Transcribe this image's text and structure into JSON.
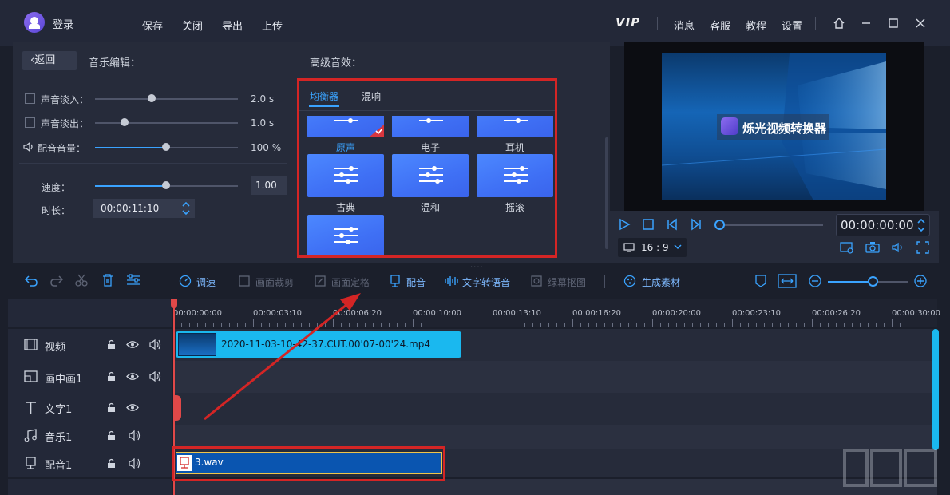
{
  "topbar": {
    "login": "登录",
    "menu": [
      "保存",
      "关闭",
      "导出",
      "上传"
    ],
    "vip": "VIP",
    "right_menu": [
      "消息",
      "客服",
      "教程",
      "设置"
    ]
  },
  "music_editor": {
    "back_label": "返回",
    "title": "音乐编辑：",
    "fade_in_label": "声音淡入：",
    "fade_in_value": "2.0 s",
    "fade_out_label": "声音淡出：",
    "fade_out_value": "1.0 s",
    "volume_label": "配音音量：",
    "volume_value": "100 %",
    "speed_label": "速度：",
    "speed_value": "1.00",
    "duration_label": "时长：",
    "duration_value": "00:00:11:10"
  },
  "advanced": {
    "title": "高级音效：",
    "tabs": [
      "均衡器",
      "混响"
    ],
    "presets_row1": [
      "原声",
      "电子",
      "耳机"
    ],
    "presets_row2": [
      "古典",
      "温和",
      "摇滚"
    ]
  },
  "preview": {
    "watermark": "烁光视频转换器",
    "time": "00:00:00:00",
    "ratio": "16 : 9"
  },
  "toolbar": {
    "speed": "调速",
    "crop": "画面裁剪",
    "freeze": "画面定格",
    "dub": "配音",
    "tts": "文字转语音",
    "greenscreen": "绿幕抠图",
    "generate": "生成素材"
  },
  "ruler": [
    "00:00:00:00",
    "00:00:03:10",
    "00:00:06:20",
    "00:00:10:00",
    "00:00:13:10",
    "00:00:16:20",
    "00:00:20:00",
    "00:00:23:10",
    "00:00:26:20",
    "00:00:30:00"
  ],
  "tracks": {
    "video": "视频",
    "pip": "画中画1",
    "text": "文字1",
    "music": "音乐1",
    "dub": "配音1"
  },
  "clips": {
    "video_file": "2020-11-03-10-42-37.CUT.00'07-00'24.mp4",
    "audio_file": "3.wav"
  },
  "colors": {
    "accent": "#3aa3ff",
    "annotation_red": "#d42525",
    "video_clip": "#1ab8ef",
    "audio_clip": "#0a55b0"
  }
}
